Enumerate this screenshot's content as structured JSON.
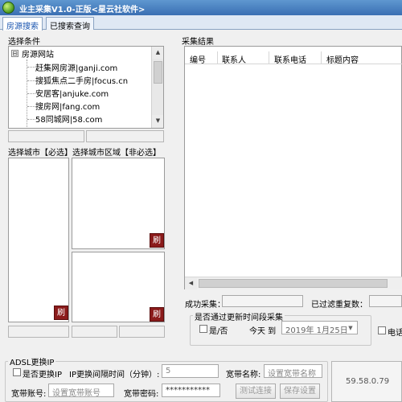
{
  "window": {
    "title": "业主采集V1.0-正版<星云社软件>"
  },
  "tabs": [
    {
      "label": "房源搜索"
    },
    {
      "label": "已搜索查询"
    }
  ],
  "left": {
    "conditions_label": "选择条件",
    "tree": {
      "root_toggle": "⊟",
      "root": "房源网站",
      "items": [
        "赶集网房源|ganji.com",
        "搜狐焦点二手房|focus.cn",
        "安居客|anjuke.com",
        "搜房网|fang.com",
        "58同城网|58.com"
      ]
    },
    "city_label": "选择城市【必选】选择城市区域【非必选】",
    "refresh_label": "刷"
  },
  "results": {
    "label": "采集结果",
    "columns": [
      "编号",
      "联系人",
      "联系电话",
      "标题内容"
    ],
    "success_label": "成功采集：",
    "filtered_label": "已过滤重复数："
  },
  "schedule": {
    "label": "是否通过更新时间段采集",
    "yes_no_label": "是/否",
    "today_label": "今天 到",
    "date_value": "2019年 1月25日"
  },
  "phone_checkbox_label": "电话",
  "adsl": {
    "group_label": "ADSL更换IP",
    "change_ip_label": "是否更换IP",
    "interval_label": "IP更换间隔时间（分钟）:",
    "interval_value": "5",
    "bb_name_label": "宽带名称:",
    "bb_name_placeholder": "设置宽带名称",
    "bb_account_label": "宽带账号:",
    "bb_account_placeholder": "设置宽带账号",
    "bb_password_label": "宽带密码:",
    "bb_password_value": "***********",
    "test_button": "测试连接",
    "save_button": "保存设置",
    "ip_value": "59.58.0.79"
  },
  "icons": {
    "scroll_up": "▲",
    "scroll_down": "▼",
    "scroll_left": "◀",
    "scroll_right": "▶",
    "dropdown": "▼"
  }
}
